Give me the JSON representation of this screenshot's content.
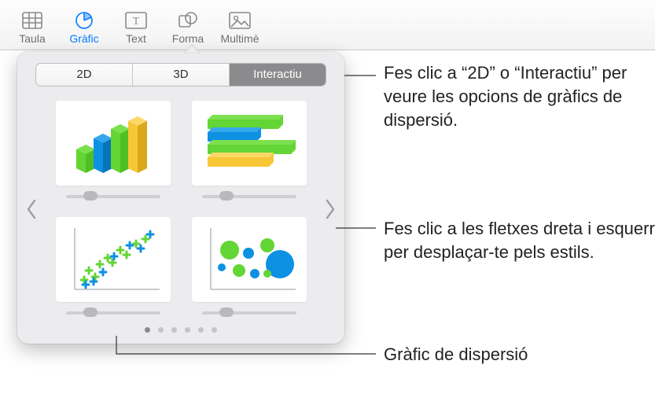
{
  "toolbar": {
    "items": [
      {
        "label": "Taula",
        "name": "toolbar-table",
        "icon": "table-icon"
      },
      {
        "label": "Gràfic",
        "name": "toolbar-chart",
        "icon": "pie-icon",
        "active": true
      },
      {
        "label": "Text",
        "name": "toolbar-text",
        "icon": "textbox-icon"
      },
      {
        "label": "Forma",
        "name": "toolbar-shape",
        "icon": "shape-icon"
      },
      {
        "label": "Multimè",
        "name": "toolbar-media",
        "icon": "image-icon"
      }
    ]
  },
  "popover": {
    "tabs": {
      "tab2d": "2D",
      "tab3d": "3D",
      "tabInteractive": "Interactiu",
      "selected": "Interactiu"
    },
    "thumbs": {
      "bar3d": "bar-chart-3d",
      "hbar3d": "hbar-chart-3d",
      "scatter": "scatter-chart",
      "bubble": "bubble-chart"
    },
    "page_dots": 6,
    "active_dot": 0
  },
  "callouts": {
    "c1": "Fes clic a “2D” o “Interactiu” per veure les opcions de gràfics de dispersió.",
    "c2": "Fes clic a les fletxes dreta i esquerra per desplaçar-te pels estils.",
    "c3": "Gràfic de dispersió"
  },
  "colors": {
    "green": "#63d534",
    "blue": "#0d91e2",
    "yellow": "#f7c737"
  }
}
